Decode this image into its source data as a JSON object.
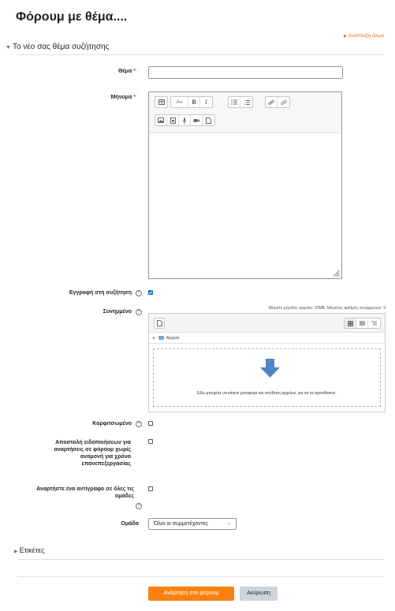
{
  "page": {
    "title": "Φόρουμ με θέμα...."
  },
  "expand_all": "Ανάπτυξη όλων",
  "section": {
    "title": "Το νέο σας θέμα συζήτησης"
  },
  "fields": {
    "subject": {
      "label": "Θέμα",
      "value": ""
    },
    "message": {
      "label": "Μήνυμα"
    },
    "subscribe": {
      "label": "Εγγραφή στη συζήτηση",
      "checked": true
    },
    "attachment": {
      "label": "Συνημμένο"
    },
    "pinned": {
      "label": "Καρφιτσωμένο",
      "checked": false
    },
    "send_now": {
      "label": "Αποστολή ειδοποιήσεων για αναρτήσεις σε φόρουμ χωρίς αναμονή για χρόνο επανεπεξεργασίας",
      "checked": false
    },
    "post_copy": {
      "label": "Αναρτήστε ένα αντίγραφο σε όλες τις ομάδες",
      "checked": false
    },
    "group": {
      "label": "Ομάδα",
      "selected": "Όλοι οι συμμετέχοντες"
    }
  },
  "required_marker": "*",
  "help_glyph": "?",
  "editor": {
    "toolbar_row1": [
      "table-icon",
      "font-size-icon",
      "bold-icon",
      "italic-icon",
      "unordered-list-icon",
      "ordered-list-icon",
      "link-icon",
      "unlink-icon"
    ],
    "toolbar_row2": [
      "image-icon",
      "media-icon",
      "microphone-icon",
      "video-icon",
      "manage-files-icon"
    ],
    "font_size_glyph": "A",
    "bold_glyph": "B",
    "italic_glyph": "I"
  },
  "filepicker": {
    "max_info": "Μέγιστο μέγεθος αρχείου: 20MB, Μέγιστος αριθμός συνημμένων: 9",
    "folder": "Αρχεία",
    "drop_text": "Εδώ μπορείτε να κάνετε μεταφορά και απόθεση αρχείων, για να τα προσθέσετε."
  },
  "tags": {
    "label": "Ετικέτες"
  },
  "buttons": {
    "submit": "Ανάρτηση στο φόρουμ",
    "cancel": "Ακύρωση"
  },
  "colors": {
    "accent": "#f98012",
    "link": "#e06d10",
    "required": "#ca3120",
    "checkbox": "#0f6cbf"
  }
}
